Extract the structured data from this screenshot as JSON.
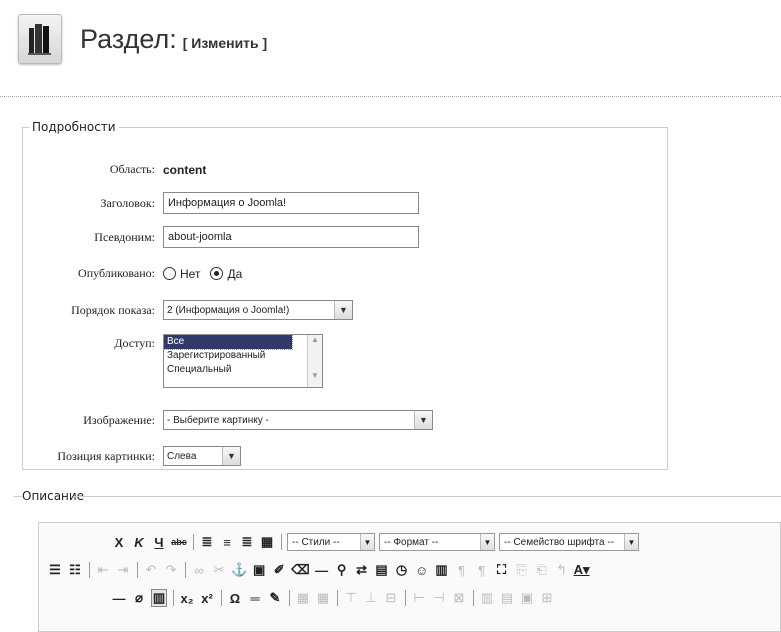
{
  "header": {
    "title": "Раздел:",
    "subtitle": "[ Изменить ]",
    "icon": "section-icon"
  },
  "details": {
    "legend": "Подробности",
    "area_label": "Область:",
    "area_value": "content",
    "title_label": "Заголовок:",
    "title_value": "Информация о Joomla!",
    "alias_label": "Псевдоним:",
    "alias_value": "about-joomla",
    "published_label": "Опубликовано:",
    "published_no": "Нет",
    "published_yes": "Да",
    "published_selected": "Да",
    "order_label": "Порядок показа:",
    "order_value": "2 (Информация о Joomla!)",
    "access_label": "Доступ:",
    "access_options": [
      "Все",
      "Зарегистрированный",
      "Специальный"
    ],
    "access_selected": "Все",
    "image_label": "Изображение:",
    "image_value": "- Выберите картинку -",
    "image_pos_label": "Позиция картинки:",
    "image_pos_value": "Слева"
  },
  "description": {
    "legend": "Описание"
  },
  "editor": {
    "styles_label": "-- Стили --",
    "format_label": "-- Формат --",
    "font_label": "-- Семейство шрифта --"
  }
}
